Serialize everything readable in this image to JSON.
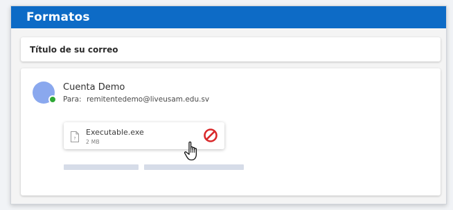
{
  "header": {
    "title": "Formatos"
  },
  "email": {
    "subject": "Título de su correo",
    "sender": {
      "name": "Cuenta Demo",
      "to_label": "Para:",
      "to_address": "remitentedemo@liveusam.edu.sv",
      "avatar_color": "#8aa8ee",
      "presence_status": "online",
      "presence_color": "#2ea836"
    },
    "attachment": {
      "file_name": "Executable.exe",
      "file_size": "2 MB",
      "file_icon": "unknown-file-icon",
      "status_icon": "blocked-icon",
      "status_color": "#d9282a"
    }
  },
  "colors": {
    "header_bg": "#0d6bc6",
    "page_bg": "#f1f3f6",
    "placeholder": "#d6dce8"
  },
  "cursor": "hand-pointer-icon"
}
